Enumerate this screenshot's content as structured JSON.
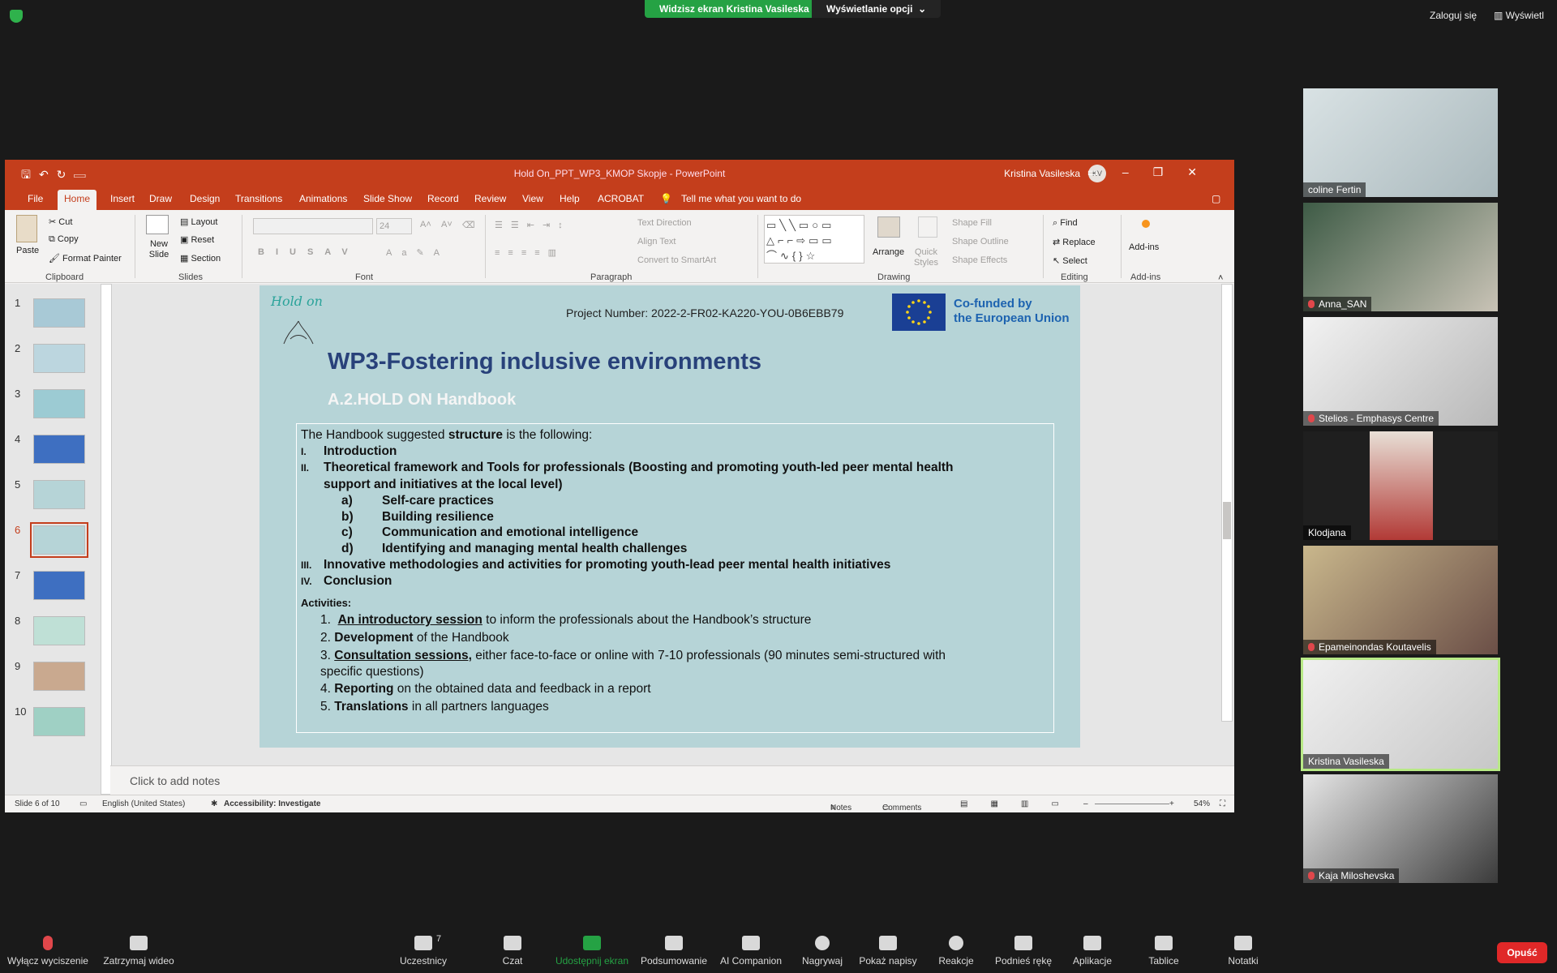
{
  "zoom_top": {
    "sharing_banner": "Widzisz ekran Kristina Vasileska",
    "view_options": "Wyświetlanie opcji",
    "login": "Zaloguj się",
    "view": "Wyświetl"
  },
  "ppt": {
    "doc_title": "Hold On_PPT_WP3_KMOP Skopje  -  PowerPoint",
    "user_name": "Kristina Vasileska",
    "user_initials": "KV",
    "tabs": [
      "File",
      "Home",
      "Insert",
      "Draw",
      "Design",
      "Transitions",
      "Animations",
      "Slide Show",
      "Record",
      "Review",
      "View",
      "Help",
      "ACROBAT"
    ],
    "tell_me": "Tell me what you want to do",
    "ribbon": {
      "paste": "Paste",
      "cut": "Cut",
      "copy": "Copy",
      "format_painter": "Format Painter",
      "clipboard": "Clipboard",
      "new_slide": "New Slide",
      "layout": "Layout",
      "reset": "Reset",
      "section": "Section",
      "slides": "Slides",
      "font_size": "24",
      "font": "Font",
      "text_direction": "Text Direction",
      "align_text": "Align Text",
      "convert_smartart": "Convert to SmartArt",
      "paragraph": "Paragraph",
      "arrange": "Arrange",
      "quick_styles": "Quick Styles",
      "shape_fill": "Shape Fill",
      "shape_outline": "Shape Outline",
      "shape_effects": "Shape Effects",
      "drawing": "Drawing",
      "find": "Find",
      "replace": "Replace",
      "select": "Select",
      "editing": "Editing",
      "addins": "Add-ins",
      "addins_group": "Add-ins"
    },
    "thumb_numbers": [
      "1",
      "2",
      "3",
      "4",
      "5",
      "6",
      "7",
      "8",
      "9",
      "10"
    ],
    "notes_placeholder": "Click to add notes",
    "status": {
      "slide_of": "Slide 6 of 10",
      "language": "English (United States)",
      "accessibility": "Accessibility: Investigate",
      "notes": "Notes",
      "comments": "Comments",
      "zoom": "54%"
    }
  },
  "slide": {
    "logo": "Hold on",
    "project_number": "Project Number: 2022-2-FR02-KA220-YOU-0B6EBB79",
    "eu_line1": "Co-funded by",
    "eu_line2": "the European Union",
    "title": "WP3-Fostering inclusive environments",
    "subtitle": "A.2.HOLD ON Handbook",
    "intro_pre": "The Handbook suggested ",
    "intro_bold": "structure",
    "intro_post": " is the following:",
    "items": [
      {
        "num": "I.",
        "text": "Introduction"
      },
      {
        "num": "II.",
        "text": "Theoretical framework and Tools for professionals (Boosting and promoting youth-led peer mental health",
        "text2": "support and initiatives at the local level)"
      },
      {
        "num": "III.",
        "text": "Innovative methodologies and activities for promoting youth-lead peer mental health initiatives"
      },
      {
        "num": "IV.",
        "text": "Conclusion"
      }
    ],
    "subitems": [
      {
        "num": "a)",
        "text": "Self-care practices"
      },
      {
        "num": "b)",
        "text": "Building resilience"
      },
      {
        "num": "c)",
        "text": "Communication and emotional intelligence"
      },
      {
        "num": "d)",
        "text": "Identifying and managing mental health challenges"
      }
    ],
    "activities_label": "Activities:",
    "activities": [
      {
        "num": "1.",
        "bold": "An introductory session",
        "rest": " to inform the professionals about the Handbook’s structure"
      },
      {
        "num": "2.",
        "bold": "Development",
        "rest": " of the Handbook"
      },
      {
        "num": "3.",
        "bold": "Consultation sessions,",
        "rest": " either face-to-face or online with 7-10 professionals (90 minutes semi-structured with",
        "rest2": "specific questions)"
      },
      {
        "num": "4.",
        "bold": "Reporting",
        "rest": " on the obtained data and feedback in a report"
      },
      {
        "num": "5.",
        "bold": "Translations",
        "rest": " in all partners languages"
      }
    ]
  },
  "participants": [
    {
      "name": "coline Fertin",
      "muted": false
    },
    {
      "name": "Anna_SAN",
      "muted": true
    },
    {
      "name": "Stelios - Emphasys Centre",
      "muted": true
    },
    {
      "name": "Klodjana",
      "muted": false
    },
    {
      "name": "Epameinondas Koutavelis",
      "muted": true
    },
    {
      "name": "Kristina Vasileska",
      "muted": false
    },
    {
      "name": "Kaja Miloshevska",
      "muted": true
    }
  ],
  "toolbar": {
    "mute": "Wyłącz wyciszenie",
    "video": "Zatrzymaj wideo",
    "participants": "Uczestnicy",
    "participants_count": "7",
    "chat": "Czat",
    "share": "Udostępnij ekran",
    "summary": "Podsumowanie",
    "companion": "AI Companion",
    "record": "Nagrywaj",
    "captions": "Pokaż napisy",
    "reactions": "Reakcje",
    "raise_hand": "Podnieś rękę",
    "apps": "Aplikacje",
    "whiteboards": "Tablice",
    "notes": "Notatki",
    "end": "Opuść"
  },
  "colors": {
    "ppt_accent": "#c43e1c",
    "slide_bg": "#b6d4d7",
    "title_color": "#28417a",
    "zoom_green": "#25a244",
    "end_red": "#e02828"
  }
}
